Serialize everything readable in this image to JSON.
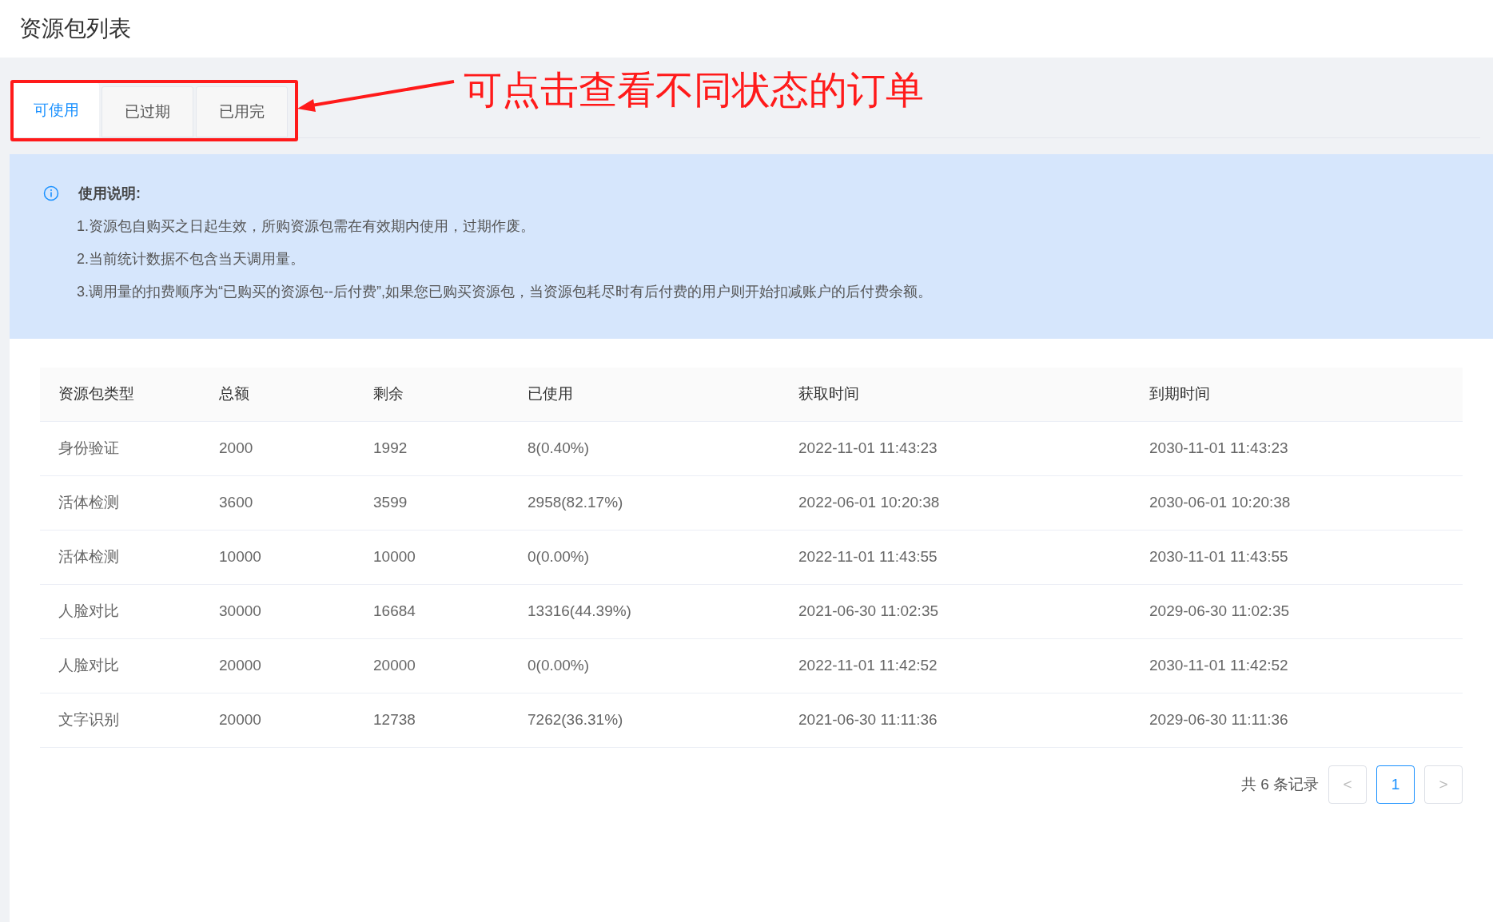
{
  "page_title": "资源包列表",
  "tabs": [
    {
      "label": "可使用",
      "selected": true
    },
    {
      "label": "已过期",
      "selected": false
    },
    {
      "label": "已用完",
      "selected": false
    }
  ],
  "annotation": "可点击查看不同状态的订单",
  "notice": {
    "title": "使用说明:",
    "lines": [
      "1.资源包自购买之日起生效，所购资源包需在有效期内使用，过期作废。",
      "2.当前统计数据不包含当天调用量。",
      "3.调用量的扣费顺序为“已购买的资源包--后付费”,如果您已购买资源包，当资源包耗尽时有后付费的用户则开始扣减账户的后付费余额。"
    ]
  },
  "table": {
    "columns": [
      "资源包类型",
      "总额",
      "剩余",
      "已使用",
      "获取时间",
      "到期时间"
    ],
    "rows": [
      [
        "身份验证",
        "2000",
        "1992",
        "8(0.40%)",
        "2022-11-01 11:43:23",
        "2030-11-01 11:43:23"
      ],
      [
        "活体检测",
        "3600",
        "3599",
        "2958(82.17%)",
        "2022-06-01 10:20:38",
        "2030-06-01 10:20:38"
      ],
      [
        "活体检测",
        "10000",
        "10000",
        "0(0.00%)",
        "2022-11-01 11:43:55",
        "2030-11-01 11:43:55"
      ],
      [
        "人脸对比",
        "30000",
        "16684",
        "13316(44.39%)",
        "2021-06-30 11:02:35",
        "2029-06-30 11:02:35"
      ],
      [
        "人脸对比",
        "20000",
        "20000",
        "0(0.00%)",
        "2022-11-01 11:42:52",
        "2030-11-01 11:42:52"
      ],
      [
        "文字识别",
        "20000",
        "12738",
        "7262(36.31%)",
        "2021-06-30 11:11:36",
        "2029-06-30 11:11:36"
      ]
    ]
  },
  "pagination": {
    "total": "共 6 条记录",
    "prev": "<",
    "pages": [
      {
        "label": "1",
        "selected": true
      }
    ],
    "next": ">"
  }
}
